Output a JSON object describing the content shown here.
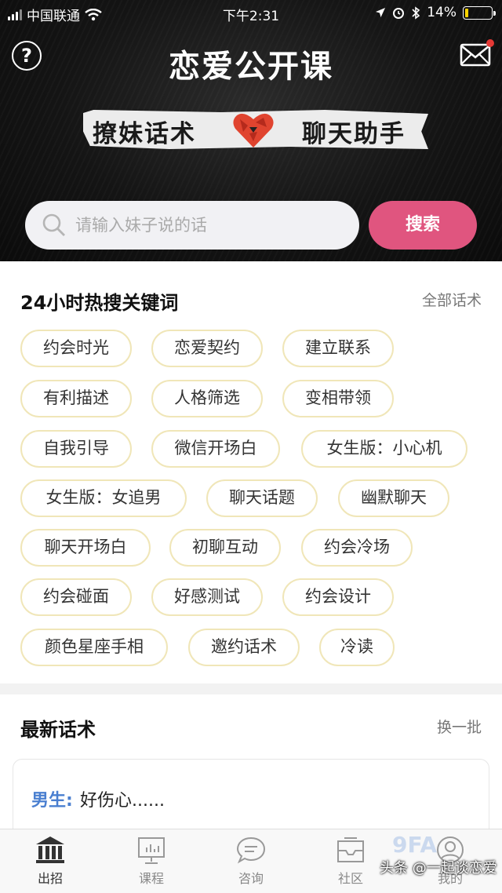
{
  "status_bar": {
    "carrier": "中国联通",
    "time": "下午2:31",
    "battery": "14%",
    "battery_level": 0.14
  },
  "header": {
    "title": "恋爱公开课",
    "help_symbol": "?",
    "banner_left": "撩妹话术",
    "banner_right": "聊天助手",
    "notification_color": "#e53935"
  },
  "search": {
    "placeholder": "请输入妹子说的话",
    "button_label": "搜索",
    "button_color": "#e0557f"
  },
  "hot_keywords": {
    "title": "24小时热搜关键词",
    "link": "全部话术",
    "tags": [
      "约会时光",
      "恋爱契约",
      "建立联系",
      "有利描述",
      "人格筛选",
      "变相带领",
      "自我引导",
      "微信开场白",
      "女生版：小心机",
      "女生版：女追男",
      "聊天话题",
      "幽默聊天",
      "聊天开场白",
      "初聊互动",
      "约会冷场",
      "约会碰面",
      "好感测试",
      "约会设计",
      "颜色星座手相",
      "邀约话术",
      "冷读"
    ]
  },
  "latest": {
    "title": "最新话术",
    "link": "换一批",
    "card": {
      "speaker": "男生:",
      "text": "好伤心......"
    }
  },
  "nav": {
    "items": [
      {
        "label": "出招",
        "icon": "temple-icon"
      },
      {
        "label": "课程",
        "icon": "chart-board-icon"
      },
      {
        "label": "咨询",
        "icon": "chat-bubble-icon"
      },
      {
        "label": "社区",
        "icon": "inbox-icon"
      },
      {
        "label": "我的",
        "icon": "user-icon"
      }
    ]
  },
  "watermark": {
    "text": "头条 @一起谈恋爱",
    "logo": "9FA"
  }
}
